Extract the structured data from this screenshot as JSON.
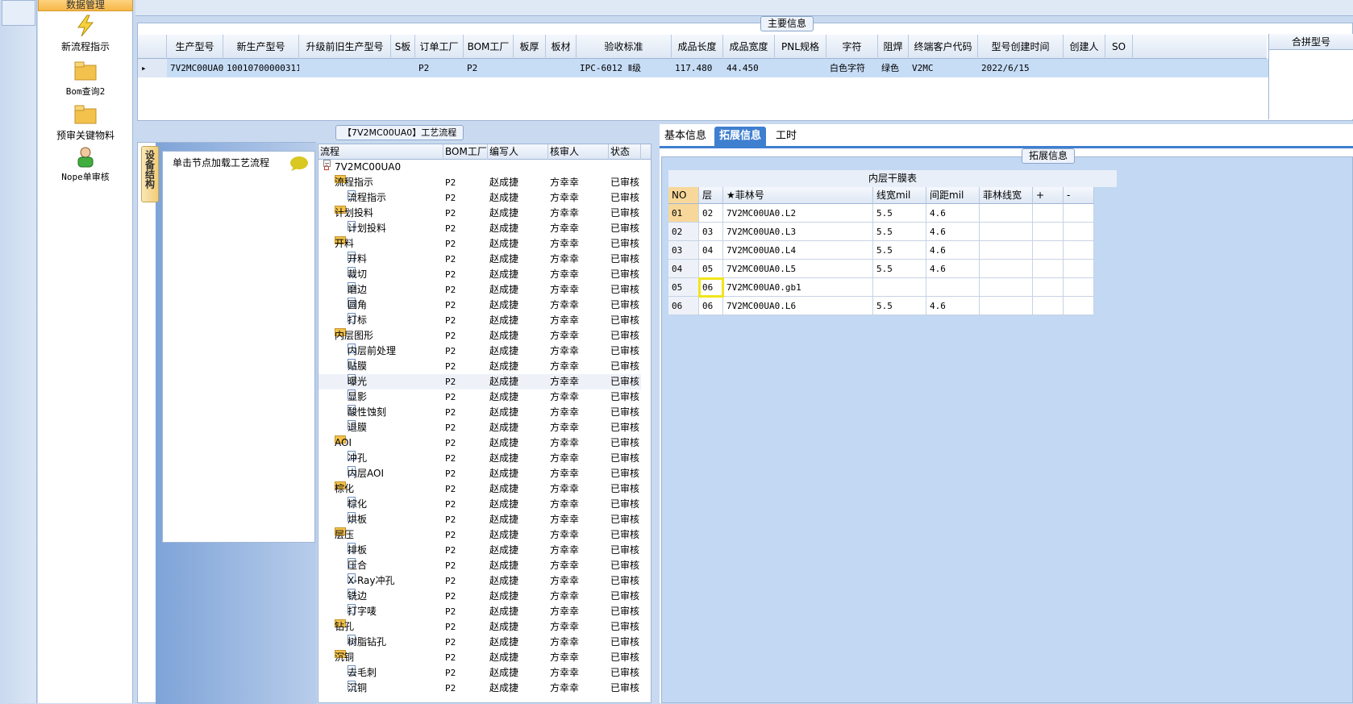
{
  "nav": {
    "header": "数据管理",
    "items": [
      {
        "label": "新流程指示",
        "icon": "lightning-icon"
      },
      {
        "label": "Bom查询2",
        "icon": "folder-icon"
      },
      {
        "label": "预审关键物料",
        "icon": "folder-icon"
      },
      {
        "label": "Nope单审核",
        "icon": "user-icon"
      }
    ]
  },
  "main": {
    "title": "主要信息",
    "columns": [
      "生产型号",
      "新生产型号",
      "升级前旧生产型号",
      "S板",
      "订单工厂",
      "BOM工厂",
      "板厚",
      "板材",
      "验收标准",
      "成品长度",
      "成品宽度",
      "PNL规格",
      "字符",
      "阻焊",
      "终端客户代码",
      "型号创建时间",
      "创建人",
      "SO"
    ],
    "row": [
      "7V2MC00UA0",
      "10010700000311",
      "",
      "",
      "P2",
      "P2",
      "",
      "",
      "IPC-6012 Ⅱ级",
      "117.480",
      "44.450",
      "",
      "白色字符",
      "绿色",
      "V2MC",
      "2022/6/15",
      "",
      ""
    ],
    "merge_label": "合拼型号"
  },
  "left": {
    "side_tab": "设备结构",
    "hint": "单击节点加载工艺流程"
  },
  "tree": {
    "title": "【7V2MC00UA0】工艺流程",
    "columns": [
      "流程",
      "BOM工厂",
      "编写人",
      "核审人",
      "状态"
    ],
    "rows": [
      {
        "name": "7V2MC00UA0",
        "level": 0,
        "type": "root"
      },
      {
        "name": "流程指示",
        "level": 1,
        "type": "folder"
      },
      {
        "name": "流程指示",
        "level": 2,
        "type": "doc"
      },
      {
        "name": "计划投料",
        "level": 1,
        "type": "folder"
      },
      {
        "name": "计划投料",
        "level": 2,
        "type": "doc"
      },
      {
        "name": "开料",
        "level": 1,
        "type": "folder"
      },
      {
        "name": "开料",
        "level": 2,
        "type": "doc"
      },
      {
        "name": "裁切",
        "level": 2,
        "type": "doc"
      },
      {
        "name": "磨边",
        "level": 2,
        "type": "doc"
      },
      {
        "name": "圆角",
        "level": 2,
        "type": "doc"
      },
      {
        "name": "打标",
        "level": 2,
        "type": "doc"
      },
      {
        "name": "内层图形",
        "level": 1,
        "type": "folder"
      },
      {
        "name": "内层前处理",
        "level": 2,
        "type": "doc"
      },
      {
        "name": "贴膜",
        "level": 2,
        "type": "doc"
      },
      {
        "name": "曝光",
        "level": 2,
        "type": "doc"
      },
      {
        "name": "显影",
        "level": 2,
        "type": "doc"
      },
      {
        "name": "酸性蚀刻",
        "level": 2,
        "type": "doc"
      },
      {
        "name": "退膜",
        "level": 2,
        "type": "doc"
      },
      {
        "name": "AOI",
        "level": 1,
        "type": "folder"
      },
      {
        "name": "冲孔",
        "level": 2,
        "type": "doc"
      },
      {
        "name": "内层AOI",
        "level": 2,
        "type": "doc"
      },
      {
        "name": "棕化",
        "level": 1,
        "type": "folder"
      },
      {
        "name": "棕化",
        "level": 2,
        "type": "doc"
      },
      {
        "name": "烘板",
        "level": 2,
        "type": "doc"
      },
      {
        "name": "层压",
        "level": 1,
        "type": "folder"
      },
      {
        "name": "排板",
        "level": 2,
        "type": "doc"
      },
      {
        "name": "压合",
        "level": 2,
        "type": "doc"
      },
      {
        "name": "X-Ray冲孔",
        "level": 2,
        "type": "doc"
      },
      {
        "name": "铣边",
        "level": 2,
        "type": "doc"
      },
      {
        "name": "打字唛",
        "level": 2,
        "type": "doc"
      },
      {
        "name": "钻孔",
        "level": 1,
        "type": "folder"
      },
      {
        "name": "树脂钻孔",
        "level": 2,
        "type": "doc"
      },
      {
        "name": "沉铜",
        "level": 1,
        "type": "folder"
      },
      {
        "name": "去毛刺",
        "level": 2,
        "type": "doc"
      },
      {
        "name": "沉铜",
        "level": 2,
        "type": "doc"
      }
    ],
    "factory": "P2",
    "writer": "赵成捷",
    "reviewer": "方幸幸",
    "status": "已审核"
  },
  "right": {
    "tabs": [
      "基本信息",
      "拓展信息",
      "工时"
    ],
    "active_tab": "拓展信息",
    "group_title": "拓展信息",
    "grid_title": "内层干膜表",
    "columns": [
      "NO",
      "层",
      "★菲林号",
      "线宽mil",
      "间距mil",
      "菲林线宽",
      "+",
      "-"
    ],
    "rows": [
      [
        "01",
        "02",
        "7V2MC00UA0.L2",
        "5.5",
        "4.6",
        "",
        "",
        ""
      ],
      [
        "02",
        "03",
        "7V2MC00UA0.L3",
        "5.5",
        "4.6",
        "",
        "",
        ""
      ],
      [
        "03",
        "04",
        "7V2MC00UA0.L4",
        "5.5",
        "4.6",
        "",
        "",
        ""
      ],
      [
        "04",
        "05",
        "7V2MC00UA0.L5",
        "5.5",
        "4.6",
        "",
        "",
        ""
      ],
      [
        "05",
        "06",
        "7V2MC00UA0.gb1",
        "",
        "",
        "",
        "",
        ""
      ],
      [
        "06",
        "06",
        "7V2MC00UA0.L6",
        "5.5",
        "4.6",
        "",
        "",
        ""
      ]
    ]
  }
}
